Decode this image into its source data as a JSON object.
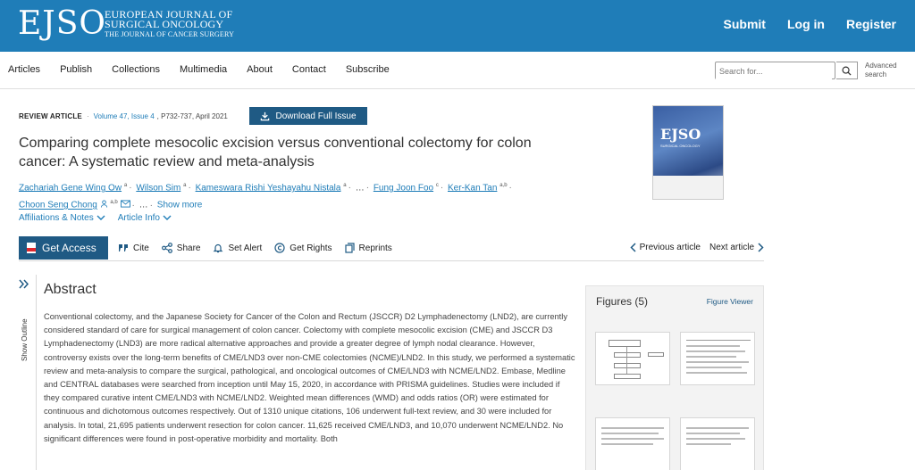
{
  "header": {
    "logo": "EJSO",
    "journal_line1": "EUROPEAN JOURNAL OF",
    "journal_line2": "SURGICAL ONCOLOGY",
    "journal_line3": "THE JOURNAL OF CANCER SURGERY",
    "submit": "Submit",
    "login": "Log in",
    "register": "Register"
  },
  "nav": {
    "items": [
      "Articles",
      "Publish",
      "Collections",
      "Multimedia",
      "About",
      "Contact",
      "Subscribe"
    ],
    "search_placeholder": "Search for...",
    "advanced_line1": "Advanced",
    "advanced_line2": "search"
  },
  "article": {
    "type": "REVIEW ARTICLE",
    "volume": "Volume 47, Issue 4",
    "pages": "P732-737, April 2021",
    "download_label": "Download Full Issue",
    "title": "Comparing complete mesocolic excision versus conventional colectomy for colon cancer: A systematic review and meta-analysis",
    "authors": [
      {
        "name": "Zachariah Gene Wing Ow",
        "sup": "a"
      },
      {
        "name": "Wilson Sim",
        "sup": "a"
      },
      {
        "name": "Kameswara Rishi Yeshayahu Nistala",
        "sup": "a"
      },
      {
        "name": "Fung Joon Foo",
        "sup": "c"
      },
      {
        "name": "Ker-Kan Tan",
        "sup": "a,b"
      },
      {
        "name": "Choon Seng Chong",
        "sup": "a,b"
      }
    ],
    "ellipsis": "…",
    "show_more": "Show more",
    "affiliations": "Affiliations & Notes",
    "article_info": "Article Info"
  },
  "cover": {
    "title": "EJSO",
    "subtitle": "SURGICAL ONCOLOGY"
  },
  "toolbar": {
    "get_access": "Get Access",
    "cite": "Cite",
    "share": "Share",
    "set_alert": "Set Alert",
    "get_rights": "Get Rights",
    "reprints": "Reprints",
    "previous": "Previous article",
    "next": "Next article"
  },
  "outline": {
    "label": "Show Outline"
  },
  "abstract": {
    "heading": "Abstract",
    "text": "Conventional colectomy, and the Japanese Society for Cancer of the Colon and Rectum (JSCCR) D2 Lymphadenectomy (LND2), are currently considered standard of care for surgical management of colon cancer. Colectomy with complete mesocolic excision (CME) and JSCCR D3 Lymphadenectomy (LND3) are more radical alternative approaches and provide a greater degree of lymph nodal clearance. However, controversy exists over the long-term benefits of CME/LND3 over non-CME colectomies (NCME)/LND2. In this study, we performed a systematic review and meta-analysis to compare the surgical, pathological, and oncological outcomes of CME/LND3 with NCME/LND2. Embase, Medline and CENTRAL databases were searched from inception until May 15, 2020, in accordance with PRISMA guidelines. Studies were included if they compared curative intent CME/LND3 with NCME/LND2. Weighted mean differences (WMD) and odds ratios (OR) were estimated for continuous and dichotomous outcomes respectively. Out of 1310 unique citations, 106 underwent full-text review, and 30 were included for analysis. In total, 21,695 patients underwent resection for colon cancer. 11,625 received CME/LND3, and 10,070 underwent NCME/LND2. No significant differences were found in post-operative morbidity and mortality. Both"
  },
  "figures": {
    "title": "Figures (5)",
    "viewer": "Figure Viewer"
  },
  "colors": {
    "header_blue": "#1f7db8",
    "button_navy": "#1f5a84",
    "pdf_red": "#e0282e"
  }
}
